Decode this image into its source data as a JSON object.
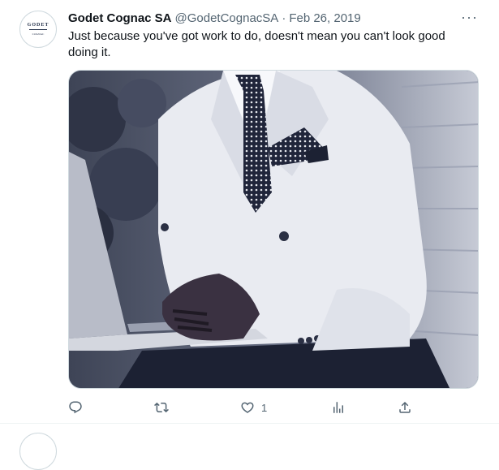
{
  "tweet": {
    "avatar": {
      "logo_word": "GODET",
      "logo_sub": "COGNAC"
    },
    "author_name": "Godet Cognac SA",
    "handle": "@GodetCognacSA",
    "separator": "·",
    "date": "Feb 26, 2019",
    "more_label": "···",
    "text": "Just because you've got work to do, doesn't mean you can't look good doing it.",
    "media": {
      "icon": "photo-man-white-suit-laptop"
    },
    "actions": {
      "reply": {
        "icon": "reply-icon",
        "count": ""
      },
      "retweet": {
        "icon": "retweet-icon",
        "count": ""
      },
      "like": {
        "icon": "heart-icon",
        "count": "1"
      },
      "views": {
        "icon": "views-icon",
        "count": ""
      },
      "share": {
        "icon": "share-icon",
        "count": ""
      }
    }
  },
  "colors": {
    "text": "#0f1419",
    "secondary": "#536471",
    "border": "#cfd9de",
    "photo_tint": "#5a6176"
  }
}
